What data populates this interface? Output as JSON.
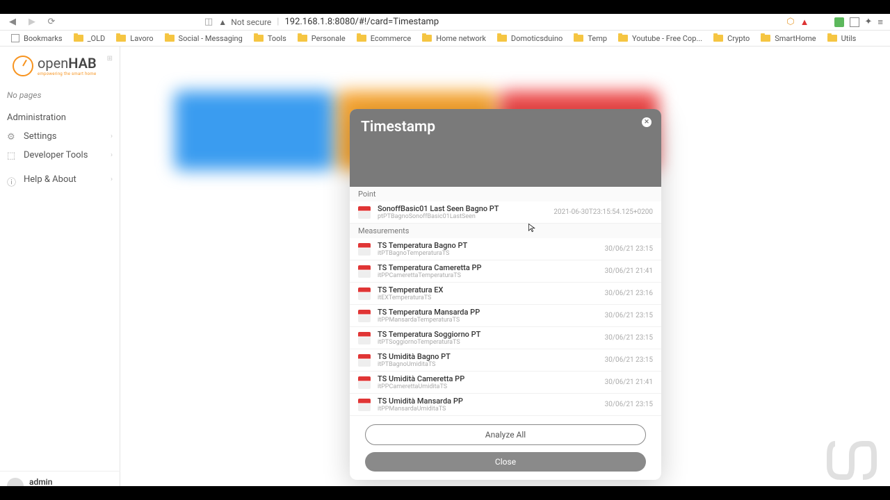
{
  "browser": {
    "not_secure": "Not secure",
    "url": "192.168.1.8:8080/#!/card=Timestamp"
  },
  "bookmarks": [
    "Bookmarks",
    "_OLD",
    "Lavoro",
    "Social - Messaging",
    "Tools",
    "Personale",
    "Ecommerce",
    "Home network",
    "Domoticsduino",
    "Temp",
    "Youtube - Free Cop...",
    "Crypto",
    "SmartHome",
    "Utils"
  ],
  "logo": {
    "brand": "open",
    "suffix": "HAB",
    "tagline": "empowering the smart home"
  },
  "sidebar": {
    "no_pages": "No pages",
    "admin": "Administration",
    "items": [
      {
        "label": "Settings"
      },
      {
        "label": "Developer Tools"
      },
      {
        "label": "Help & About"
      }
    ]
  },
  "user": {
    "name": "admin",
    "url": "http://192.168.1.8:8080"
  },
  "dialog": {
    "title": "Timestamp",
    "point_header": "Point",
    "point": {
      "title": "SonoffBasic01 Last Seen Bagno PT",
      "sub": "ptPTBagnoSonoffBasic01LastSeen",
      "value": "2021-06-30T23:15:54.125+0200"
    },
    "meas_header": "Measurements",
    "rows": [
      {
        "title": "TS Temperatura Bagno PT",
        "sub": "itPTBagnoTemperaturaTS",
        "value": "30/06/21 23:15"
      },
      {
        "title": "TS Temperatura Cameretta PP",
        "sub": "itPPCamerettaTemperaturaTS",
        "value": "30/06/21 21:41"
      },
      {
        "title": "TS Temperatura EX",
        "sub": "itEXTemperaturaTS",
        "value": "30/06/21 23:16"
      },
      {
        "title": "TS Temperatura Mansarda PP",
        "sub": "itPPMansardaTemperaturaTS",
        "value": "30/06/21 23:15"
      },
      {
        "title": "TS Temperatura Soggiorno PT",
        "sub": "itPTSoggiornoTemperaturaTS",
        "value": "30/06/21 23:15"
      },
      {
        "title": "TS Umidità Bagno PT",
        "sub": "itPTBagnoUmiditaTS",
        "value": "30/06/21 23:15"
      },
      {
        "title": "TS Umidità Cameretta PP",
        "sub": "itPPCamerettaUmiditaTS",
        "value": "30/06/21 21:41"
      },
      {
        "title": "TS Umidità Mansarda PP",
        "sub": "itPPMansardaUmiditaTS",
        "value": "30/06/21 23:15"
      }
    ],
    "analyze": "Analyze All",
    "close": "Close"
  }
}
